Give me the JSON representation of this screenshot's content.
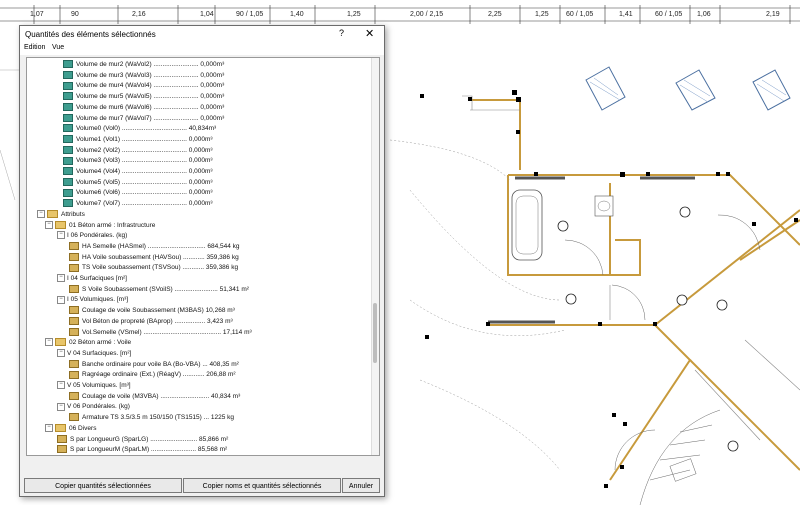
{
  "dimensions": [
    "1,07",
    "90",
    "2,16",
    "1,04",
    "90 / 1,05",
    "1,40",
    "1,25",
    "2,00 / 2,15",
    "2,25",
    "1,25",
    "60 / 1,05",
    "1,41",
    "60 / 1,05",
    "1,06",
    "2,19"
  ],
  "dialog": {
    "title": "Quantités des éléments sélectionnés",
    "help": "?",
    "close": "✕",
    "menu": [
      "Edition",
      "Vue"
    ],
    "buttons": {
      "copy_quantities": "Copier quantités sélectionnées",
      "copy_names": "Copier noms et quantités sélectionnés",
      "cancel": "Annuler"
    }
  },
  "tree": [
    {
      "level": 4,
      "icon": "q",
      "text": "Volume de mur2 (WaVol2) ......................... 0,000m³"
    },
    {
      "level": 4,
      "icon": "q",
      "text": "Volume de mur3 (WaVol3) ......................... 0,000m³"
    },
    {
      "level": 4,
      "icon": "q",
      "text": "Volume de mur4 (WaVol4) ......................... 0,000m³"
    },
    {
      "level": 4,
      "icon": "q",
      "text": "Volume de mur5 (WaVol5) ......................... 0,000m³"
    },
    {
      "level": 4,
      "icon": "q",
      "text": "Volume de mur6 (WaVol6) ......................... 0,000m³"
    },
    {
      "level": 4,
      "icon": "q",
      "text": "Volume de mur7 (WaVol7) ......................... 0,000m³"
    },
    {
      "level": 4,
      "icon": "q",
      "text": "Volume0 (Vol0) .................................... 40,834m³"
    },
    {
      "level": 4,
      "icon": "q",
      "text": "Volume1 (Vol1) .................................... 0,000m³"
    },
    {
      "level": 4,
      "icon": "q",
      "text": "Volume2 (Vol2) .................................... 0,000m³"
    },
    {
      "level": 4,
      "icon": "q",
      "text": "Volume3 (Vol3) .................................... 0,000m³"
    },
    {
      "level": 4,
      "icon": "q",
      "text": "Volume4 (Vol4) .................................... 0,000m³"
    },
    {
      "level": 4,
      "icon": "q",
      "text": "Volume5 (Vol5) .................................... 0,000m³"
    },
    {
      "level": 4,
      "icon": "q",
      "text": "Volume6 (Vol6) .................................... 0,000m³"
    },
    {
      "level": 4,
      "icon": "q",
      "text": "Volume7 (Vol7) .................................... 0,000m³"
    },
    {
      "level": 0,
      "icon": "folder",
      "exp": "−",
      "text": "Attributs"
    },
    {
      "level": 1,
      "icon": "folder",
      "exp": "−",
      "text": "01 Béton armé : Infrastructure"
    },
    {
      "level": 2,
      "icon": "none",
      "exp": "−",
      "text": "I 06 Pondérales. (kg)"
    },
    {
      "level": 3,
      "icon": "kg",
      "text": "HA Semelle (HASmel) ................................ 684,544 kg"
    },
    {
      "level": 3,
      "icon": "kg",
      "text": "HA Voile soubassement (HAVSou) ............ 359,386 kg"
    },
    {
      "level": 3,
      "icon": "kg",
      "text": "TS Voile soubassement (TSVSou) ............ 359,386 kg"
    },
    {
      "level": 2,
      "icon": "none",
      "exp": "−",
      "text": "I 04 Surfaciques [m²]"
    },
    {
      "level": 3,
      "icon": "kg",
      "text": "S Voile Soubassement (SVoilS) ........................ 51,341 m²"
    },
    {
      "level": 2,
      "icon": "none",
      "exp": "−",
      "text": "I 05 Volumiques. [m³]"
    },
    {
      "level": 3,
      "icon": "kg",
      "text": "Coulage de voile Soubassement (M3BAS) 10,268 m³"
    },
    {
      "level": 3,
      "icon": "kg",
      "text": "Vol Béton de propreté (BAprop) ................. 3,423 m³"
    },
    {
      "level": 3,
      "icon": "kg",
      "text": "Vol.Semelle (VSmel) ........................................... 17,114 m³"
    },
    {
      "level": 1,
      "icon": "folder",
      "exp": "−",
      "text": "02 Béton armé : Voile"
    },
    {
      "level": 2,
      "icon": "none",
      "exp": "−",
      "text": "V 04 Surfaciques. [m²]"
    },
    {
      "level": 3,
      "icon": "kg",
      "text": "Banche ordinaire pour voile BA (Bo-VBA) ... 408,35 m²"
    },
    {
      "level": 3,
      "icon": "kg",
      "text": "Ragréage ordinaire (Ext.) (RéagV) ............ 206,88 m²"
    },
    {
      "level": 2,
      "icon": "none",
      "exp": "−",
      "text": "V 05 Volumiques. [m³]"
    },
    {
      "level": 3,
      "icon": "kg",
      "text": "Coulage de voile (M3VBA) ........................... 40,834 m³"
    },
    {
      "level": 2,
      "icon": "none",
      "exp": "−",
      "text": "V 06 Pondérales. (kg)"
    },
    {
      "level": 3,
      "icon": "kg",
      "text": "Armature TS 3.5/3.5 m 150/150 (TS1515) ... 1225 kg"
    },
    {
      "level": 1,
      "icon": "folder",
      "exp": "−",
      "text": "06 Divers"
    },
    {
      "level": 2,
      "icon": "kg",
      "text": "S par LongueurG (SparLG) .......................... 85,866 m²"
    },
    {
      "level": 2,
      "icon": "kg",
      "text": "S par LongueurM (SparLM) ......................... 85,568 m²"
    }
  ]
}
